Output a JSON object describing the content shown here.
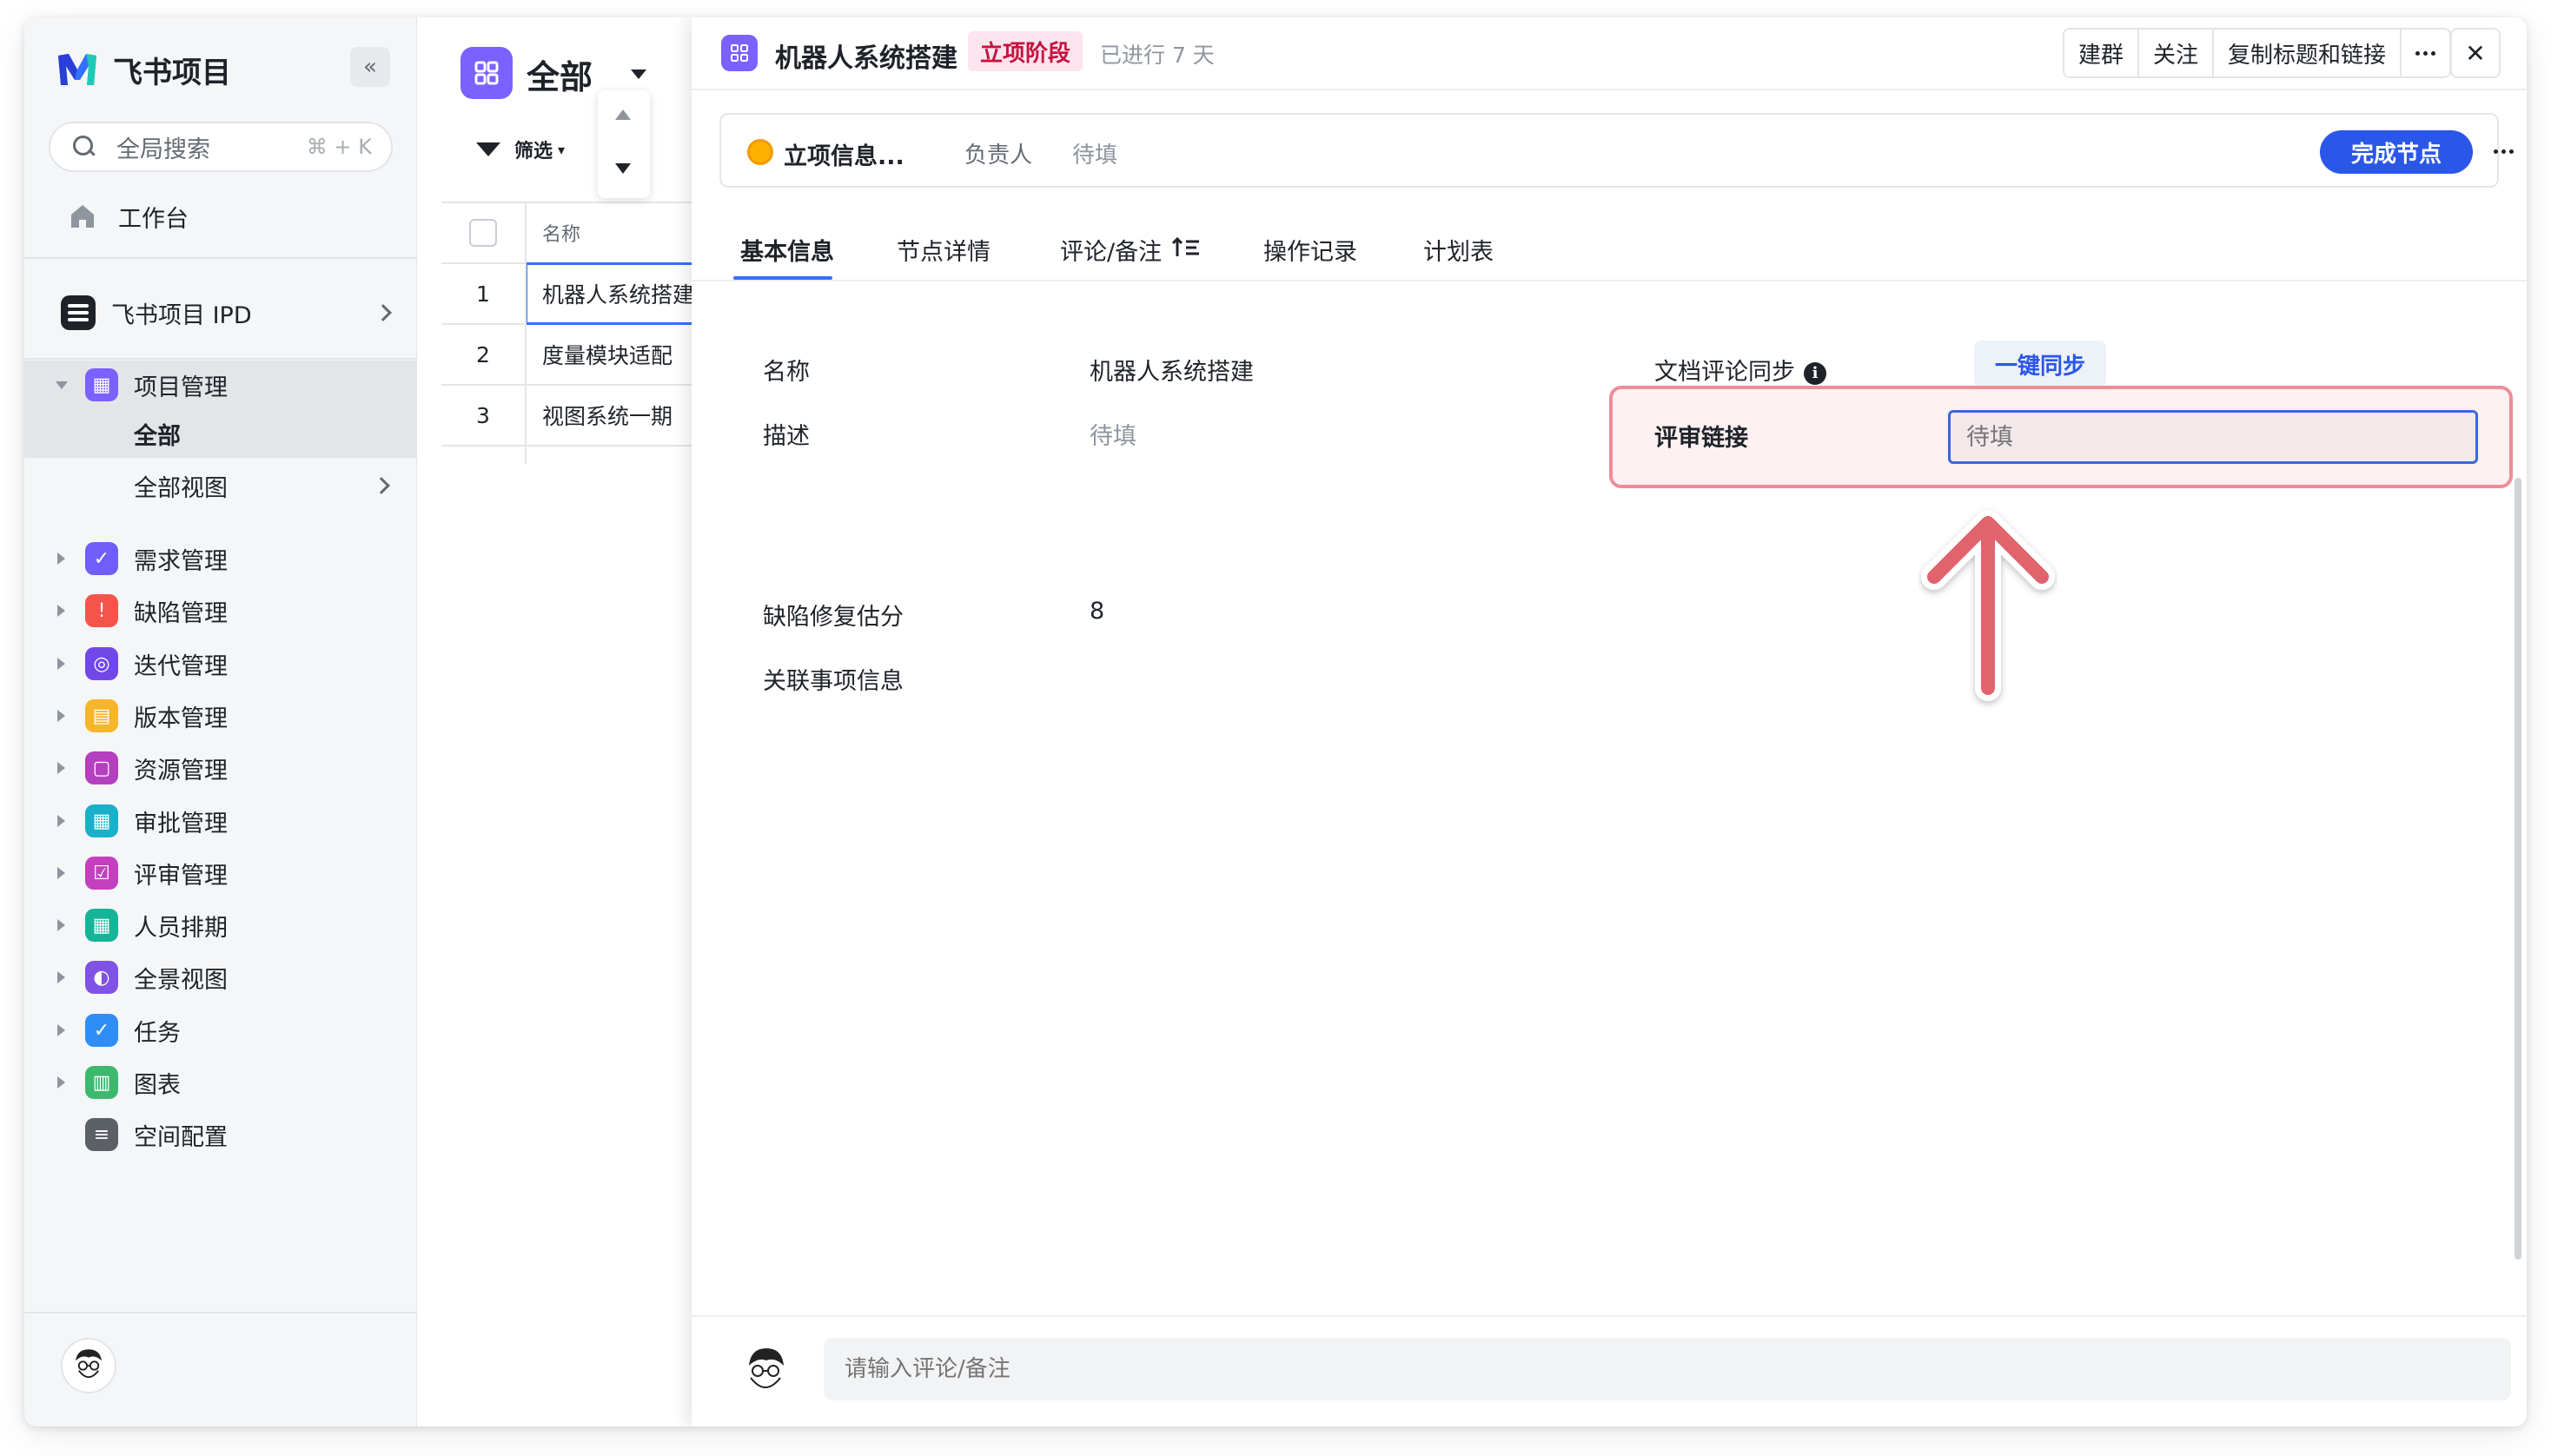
{
  "sidebar": {
    "app_name": "飞书项目",
    "collapse_icon": "«",
    "search": {
      "placeholder": "全局搜索",
      "shortcut": "⌘ + K"
    },
    "workbench": "工作台",
    "space": "飞书项目 IPD",
    "project_mgmt": "项目管理",
    "sub_items": [
      "全部",
      "全部视图"
    ],
    "modules": [
      {
        "label": "需求管理",
        "color": "#6f5ef9",
        "glyph": "✓"
      },
      {
        "label": "缺陷管理",
        "color": "#f5544a",
        "glyph": "!"
      },
      {
        "label": "迭代管理",
        "color": "#7048e8",
        "glyph": "◎"
      },
      {
        "label": "版本管理",
        "color": "#f7b52c",
        "glyph": "▤"
      },
      {
        "label": "资源管理",
        "color": "#b43fbf",
        "glyph": "▢"
      },
      {
        "label": "审批管理",
        "color": "#1ab0c9",
        "glyph": "▦"
      },
      {
        "label": "评审管理",
        "color": "#c43fbf",
        "glyph": "☑"
      },
      {
        "label": "人员排期",
        "color": "#16b59a",
        "glyph": "▦"
      },
      {
        "label": "全景视图",
        "color": "#8152e6",
        "glyph": "◐"
      },
      {
        "label": "任务",
        "color": "#2f8ef5",
        "glyph": "✓"
      },
      {
        "label": "图表",
        "color": "#3db86f",
        "glyph": "▥"
      },
      {
        "label": "空间配置",
        "color": "#5b5f66",
        "glyph": "≡"
      }
    ]
  },
  "list": {
    "title": "全部",
    "filter": "筛选",
    "column_name": "名称",
    "rows": [
      {
        "num": "1",
        "name": "机器人系统搭建"
      },
      {
        "num": "2",
        "name": "度量模块适配"
      },
      {
        "num": "3",
        "name": "视图系统一期"
      }
    ]
  },
  "detail": {
    "title": "机器人系统搭建",
    "stage": "立项阶段",
    "days": "已进行 7 天",
    "header_buttons": [
      "建群",
      "关注",
      "复制标题和链接"
    ],
    "close": "✕",
    "node": {
      "name": "立项信息...",
      "owner_label": "负责人",
      "owner_value": "待填",
      "complete": "完成节点"
    },
    "tabs": [
      "基本信息",
      "节点详情",
      "评论/备注",
      "操作记录",
      "计划表"
    ],
    "fields": {
      "name_label": "名称",
      "name_value": "机器人系统搭建",
      "desc_label": "描述",
      "desc_value": "待填",
      "sync_label": "文档评论同步",
      "sync_info": "i",
      "sync_button": "一键同步",
      "review_label": "评审链接",
      "review_placeholder": "待填",
      "defect_label": "缺陷修复估分",
      "defect_value": "8",
      "related_label": "关联事项信息"
    },
    "comment_placeholder": "请输入评论/备注"
  }
}
